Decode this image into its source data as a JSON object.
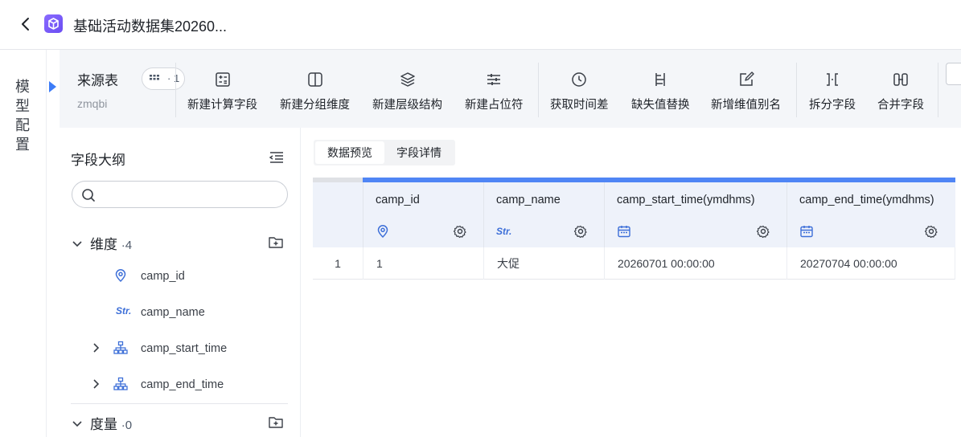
{
  "header": {
    "title": "基础活动数据集20260..."
  },
  "left_strip": {
    "label_chars": [
      "模",
      "型",
      "配",
      "置"
    ]
  },
  "source": {
    "title": "来源表",
    "count": "· 1",
    "subtitle": "zmqbi"
  },
  "toolbar": {
    "items": [
      {
        "label": "新建计算字段",
        "icon": "calculator-icon"
      },
      {
        "label": "新建分组维度",
        "icon": "split-column-icon"
      },
      {
        "label": "新建层级结构",
        "icon": "layers-icon"
      },
      {
        "label": "新建占位符",
        "icon": "sliders-icon"
      },
      {
        "label": "获取时间差",
        "icon": "clock-icon"
      },
      {
        "label": "缺失值替换",
        "icon": "replace-icon"
      },
      {
        "label": "新增维值别名",
        "icon": "edit-icon"
      },
      {
        "label": "拆分字段",
        "icon": "split-icon"
      },
      {
        "label": "合并字段",
        "icon": "merge-icon"
      }
    ]
  },
  "sidebar": {
    "title": "字段大纲",
    "search_placeholder": "",
    "dimensions": {
      "label": "维度",
      "count": "·4",
      "fields": [
        {
          "name": "camp_id",
          "type": "geo"
        },
        {
          "name": "camp_name",
          "type": "str",
          "type_label": "Str."
        },
        {
          "name": "camp_start_time",
          "type": "hierarchy"
        },
        {
          "name": "camp_end_time",
          "type": "hierarchy"
        }
      ]
    },
    "measures": {
      "label": "度量",
      "count": "·0"
    }
  },
  "main": {
    "tabs": [
      {
        "label": "数据预览",
        "active": true
      },
      {
        "label": "字段详情",
        "active": false
      }
    ],
    "table": {
      "columns": [
        {
          "name": "camp_id",
          "type": "geo"
        },
        {
          "name": "camp_name",
          "type": "str",
          "type_label": "Str."
        },
        {
          "name": "camp_start_time(ymdhms)",
          "type": "date"
        },
        {
          "name": "camp_end_time(ymdhms)",
          "type": "date"
        }
      ],
      "rows": [
        {
          "index": "1",
          "cells": [
            "1",
            "大促",
            "20260701 00:00:00",
            "20270704 00:00:00"
          ]
        }
      ]
    }
  },
  "colors": {
    "accent": "#4f85f5",
    "header_bg": "#eef2fa",
    "toolbar_bg": "#f4f6f9"
  }
}
